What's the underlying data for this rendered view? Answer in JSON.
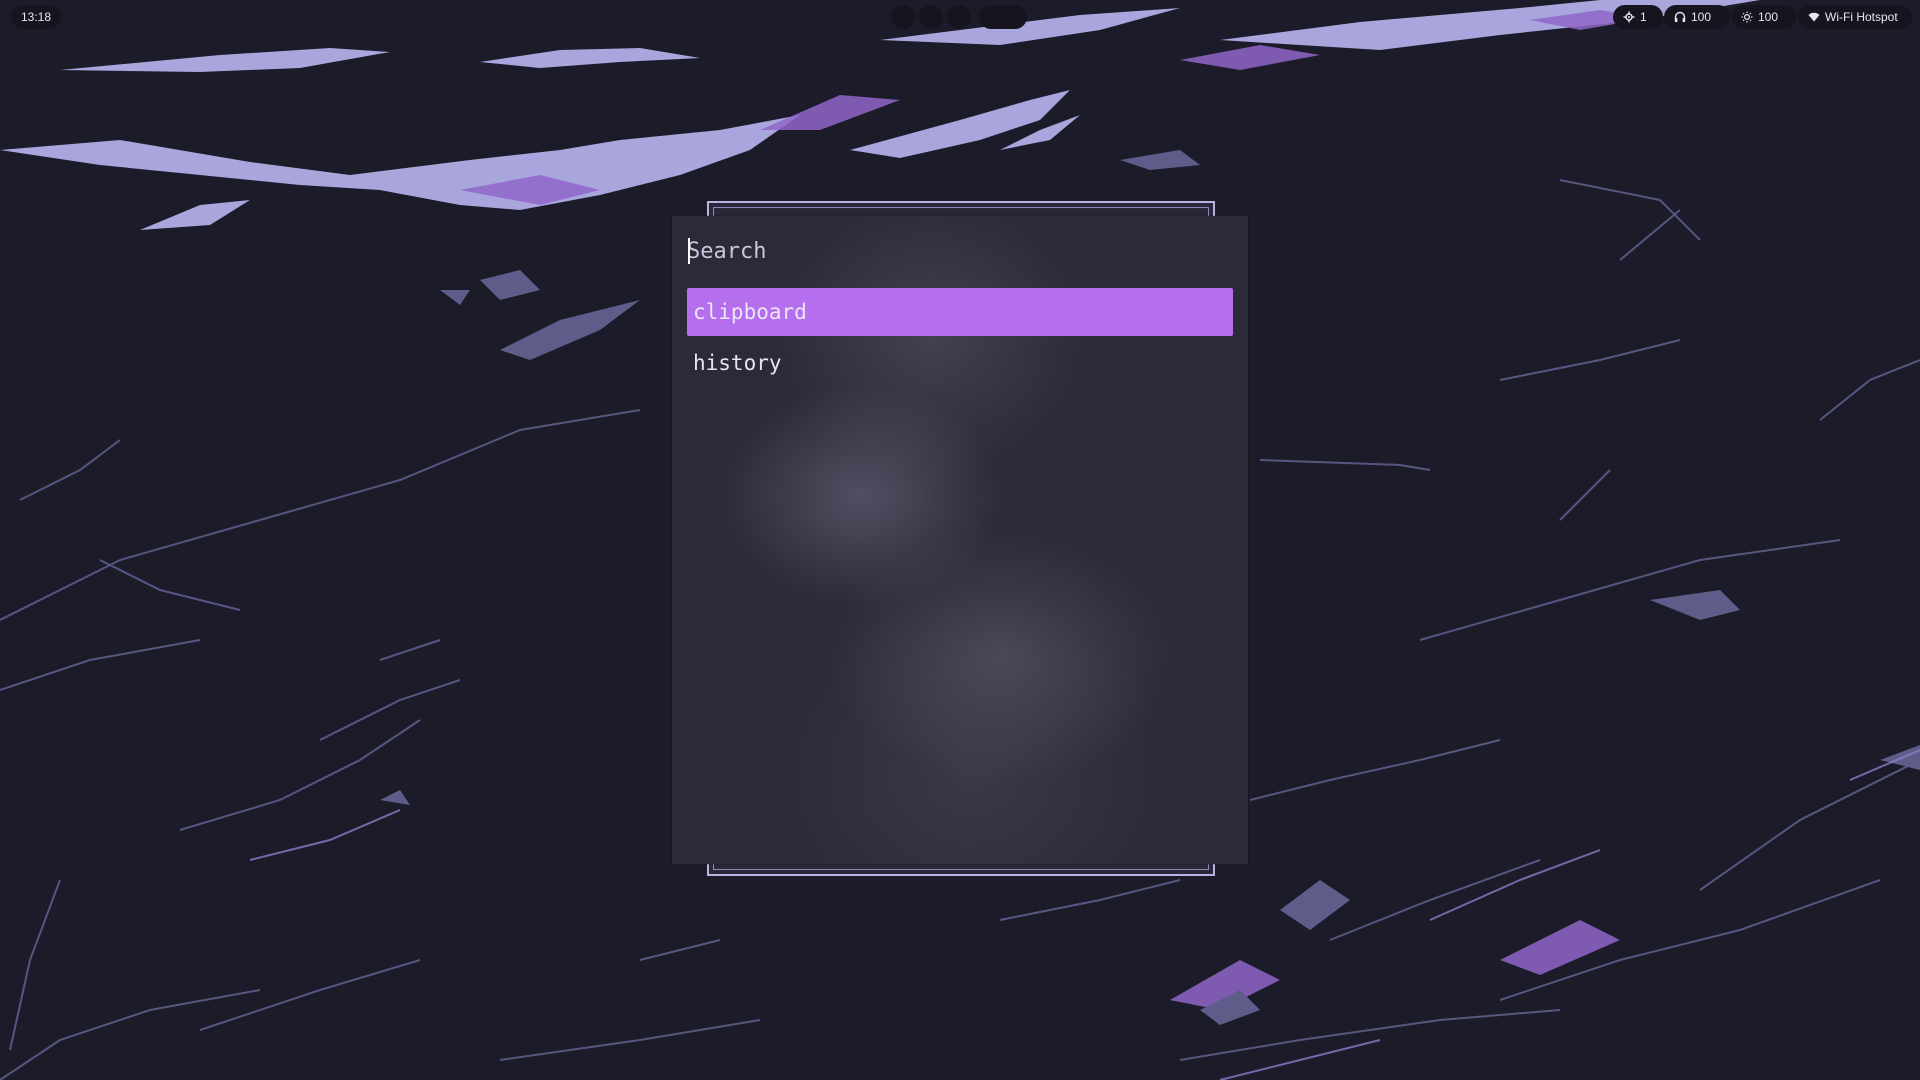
{
  "statusbar": {
    "clock": "13:18",
    "updates": {
      "icon": "gear-icon",
      "value": "1"
    },
    "volume": {
      "icon": "headphones-icon",
      "value": "100"
    },
    "brightness": {
      "icon": "sun-icon",
      "value": "100"
    },
    "network": {
      "icon": "wifi-icon",
      "label": "Wi-Fi Hotspot"
    }
  },
  "workspaces": [
    {
      "active": false
    },
    {
      "active": false
    },
    {
      "active": false
    },
    {
      "active": true
    }
  ],
  "launcher": {
    "search": {
      "placeholder": "Search",
      "value": ""
    },
    "results": [
      {
        "label": "clipboard",
        "selected": true
      },
      {
        "label": "history",
        "selected": false
      }
    ]
  },
  "theme": {
    "accent": "#b56eed",
    "background": "#1c1b29",
    "marble_vein": "#a9a5e0"
  }
}
